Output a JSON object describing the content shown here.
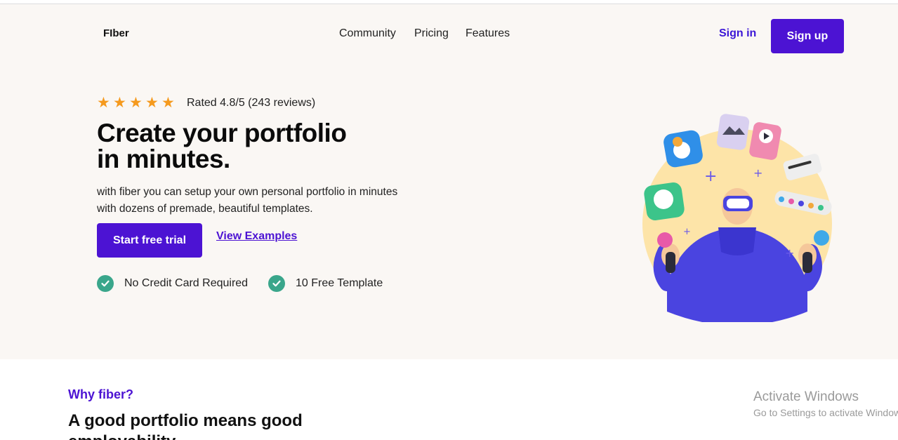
{
  "header": {
    "logo": "FIber",
    "nav": [
      "Community",
      "Pricing",
      "Features"
    ],
    "sign_in": "Sign in",
    "sign_up": "Sign up"
  },
  "hero": {
    "rating_stars": 5,
    "rating_text": "Rated 4.8/5 (243 reviews)",
    "headline_line1": "Create your portfolio",
    "headline_line2": "in minutes.",
    "subtext_line1": "with fiber you can setup your own personal portfolio in minutes",
    "subtext_line2": "with dozens of premade, beautiful templates.",
    "cta_primary": "Start free trial",
    "cta_secondary": "View Examples",
    "features": [
      "No Credit Card Required",
      "10 Free Template"
    ],
    "star_icon": "star-icon",
    "check_icon": "check-circle-icon"
  },
  "why_section": {
    "kicker": "Why fiber?",
    "title": "A good portfolio means good employability."
  },
  "watermark": {
    "title": "Activate Windows",
    "subtitle": "Go to Settings to activate Windows."
  },
  "colors": {
    "accent": "#4c13d3",
    "star": "#f59a1e",
    "check": "#3aa68b",
    "hero_bg": "#faf7f4"
  }
}
